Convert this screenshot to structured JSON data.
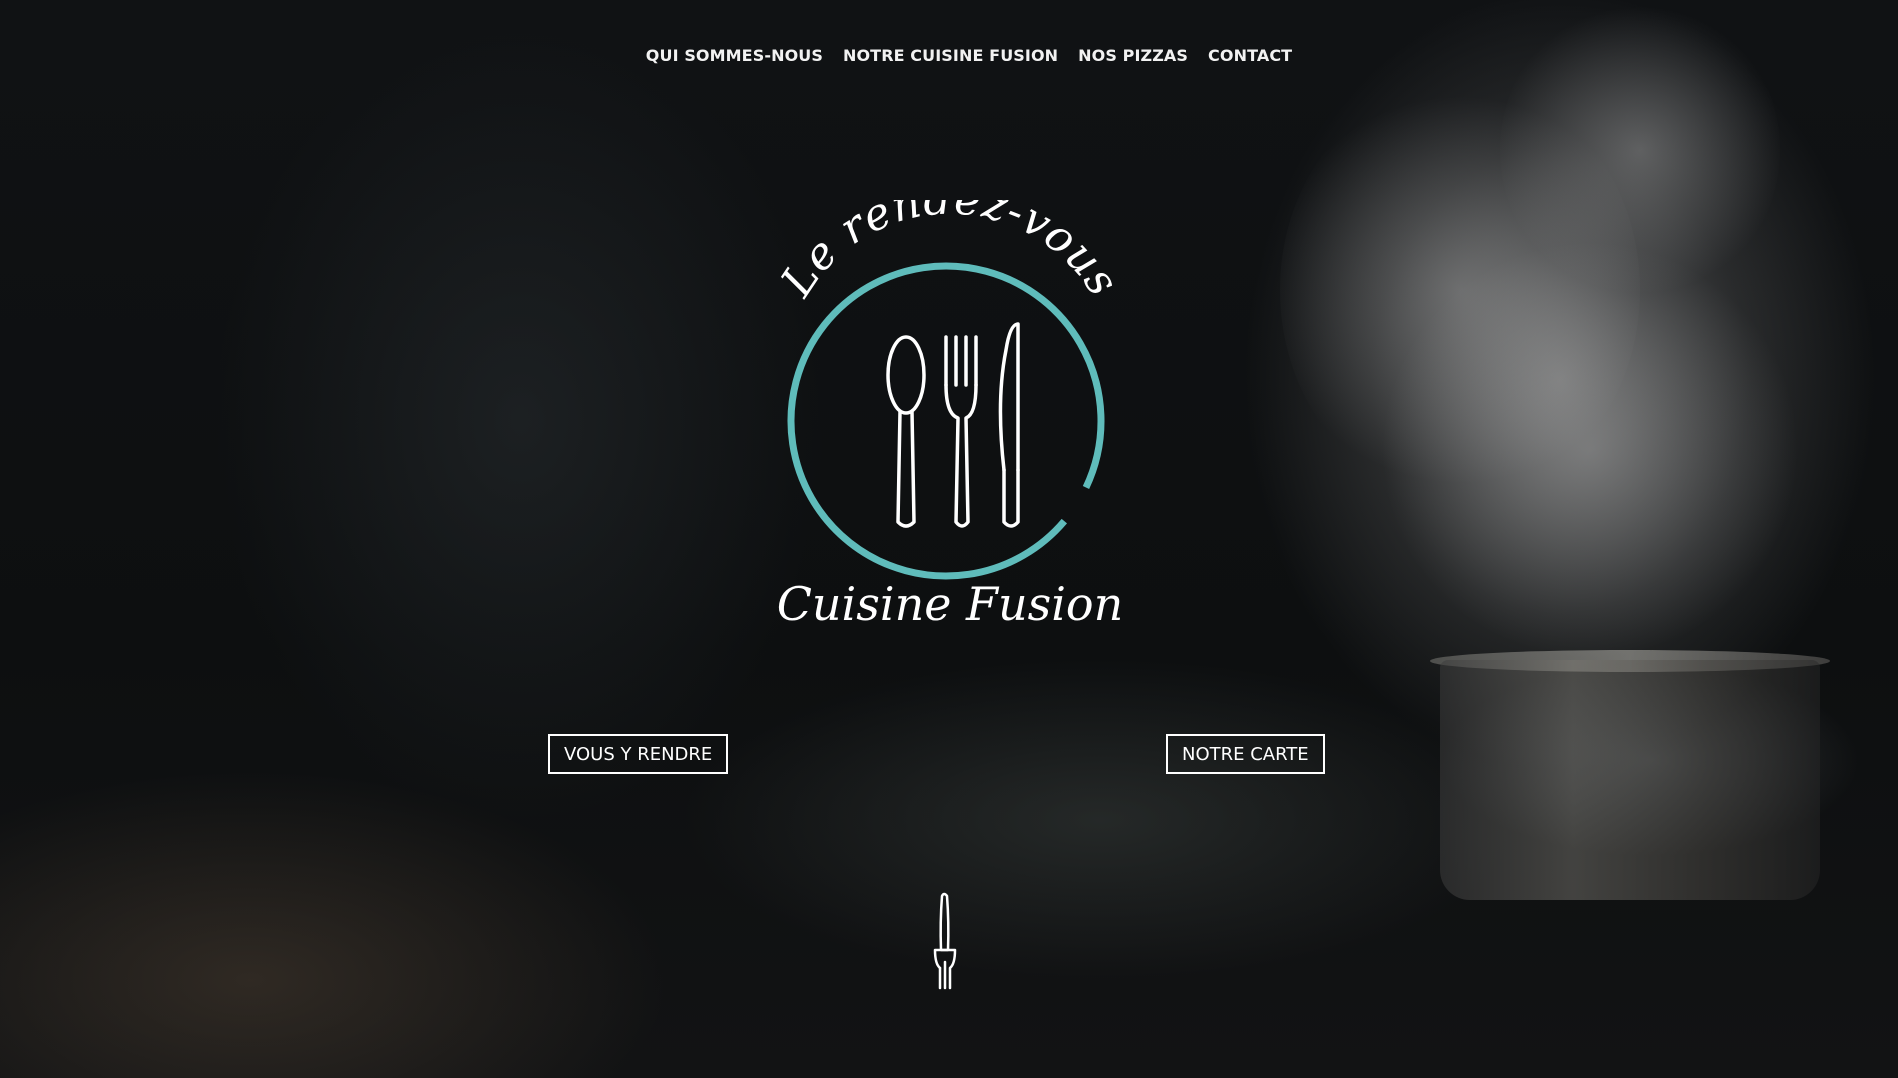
{
  "nav": {
    "items": [
      {
        "label": "QUI SOMMES-NOUS"
      },
      {
        "label": "NOTRE CUISINE FUSION"
      },
      {
        "label": "NOS PIZZAS"
      },
      {
        "label": "CONTACT"
      }
    ]
  },
  "logo": {
    "top_text": "Le rendez-vous",
    "bottom_text": "Cuisine Fusion",
    "ring_color": "#5fbcbb",
    "icon": "cutlery-icon"
  },
  "hero": {
    "left_button_label": "VOUS Y RENDRE",
    "right_button_label": "NOTRE CARTE"
  },
  "scroll_indicator": {
    "icon": "fork-icon"
  },
  "colors": {
    "accent": "#5fbcbb",
    "text": "#ffffff",
    "background": "#0b0c0d"
  }
}
